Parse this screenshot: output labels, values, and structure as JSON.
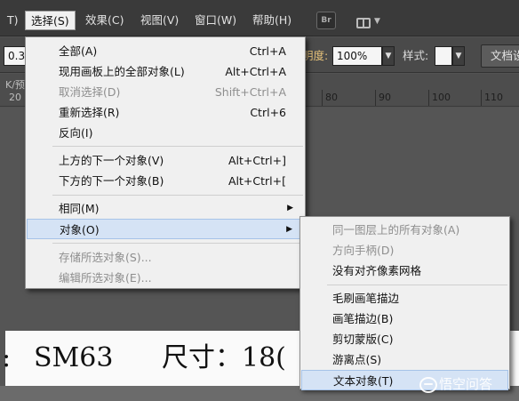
{
  "menubar": {
    "partial_left": "T)",
    "items": [
      "选择(S)",
      "效果(C)",
      "视图(V)",
      "窗口(W)",
      "帮助(H)"
    ],
    "bridge_icon_label": "Br"
  },
  "controlbar": {
    "partial_value": "0.3",
    "opacity_label": "明度:",
    "opacity_value": "100%",
    "style_label": "样式:",
    "doc_button": "文档设"
  },
  "ruler": {
    "partial_label": "K/预",
    "left_numbers": [
      "20",
      "30"
    ],
    "right_numbers": [
      "80",
      "90",
      "100",
      "110"
    ]
  },
  "select_menu": {
    "groups": [
      [
        {
          "label": "全部(A)",
          "shortcut": "Ctrl+A",
          "enabled": true
        },
        {
          "label": "现用画板上的全部对象(L)",
          "shortcut": "Alt+Ctrl+A",
          "enabled": true
        },
        {
          "label": "取消选择(D)",
          "shortcut": "Shift+Ctrl+A",
          "enabled": false
        },
        {
          "label": "重新选择(R)",
          "shortcut": "Ctrl+6",
          "enabled": true
        },
        {
          "label": "反向(I)",
          "shortcut": "",
          "enabled": true
        }
      ],
      [
        {
          "label": "上方的下一个对象(V)",
          "shortcut": "Alt+Ctrl+]",
          "enabled": true
        },
        {
          "label": "下方的下一个对象(B)",
          "shortcut": "Alt+Ctrl+[",
          "enabled": true
        }
      ],
      [
        {
          "label": "相同(M)",
          "shortcut": "",
          "submenu": true,
          "enabled": true
        },
        {
          "label": "对象(O)",
          "shortcut": "",
          "submenu": true,
          "enabled": true,
          "highlighted": true
        }
      ],
      [
        {
          "label": "存储所选对象(S)...",
          "shortcut": "",
          "enabled": false
        },
        {
          "label": "编辑所选对象(E)...",
          "shortcut": "",
          "enabled": false
        }
      ]
    ]
  },
  "object_submenu": {
    "groups": [
      [
        {
          "label": "同一图层上的所有对象(A)",
          "enabled": false
        },
        {
          "label": "方向手柄(D)",
          "enabled": false
        },
        {
          "label": "没有对齐像素网格",
          "enabled": true
        }
      ],
      [
        {
          "label": "毛刷画笔描边",
          "enabled": true
        },
        {
          "label": "画笔描边(B)",
          "enabled": true
        },
        {
          "label": "剪切蒙版(C)",
          "enabled": true
        },
        {
          "label": "游离点(S)",
          "enabled": true
        },
        {
          "label": "文本对象(T)",
          "enabled": true,
          "highlighted": true
        }
      ]
    ]
  },
  "document": {
    "left_fragment": ":",
    "code_text": "SM63",
    "size_text": "尺寸：18("
  },
  "watermark": {
    "text": "悟空问答"
  }
}
